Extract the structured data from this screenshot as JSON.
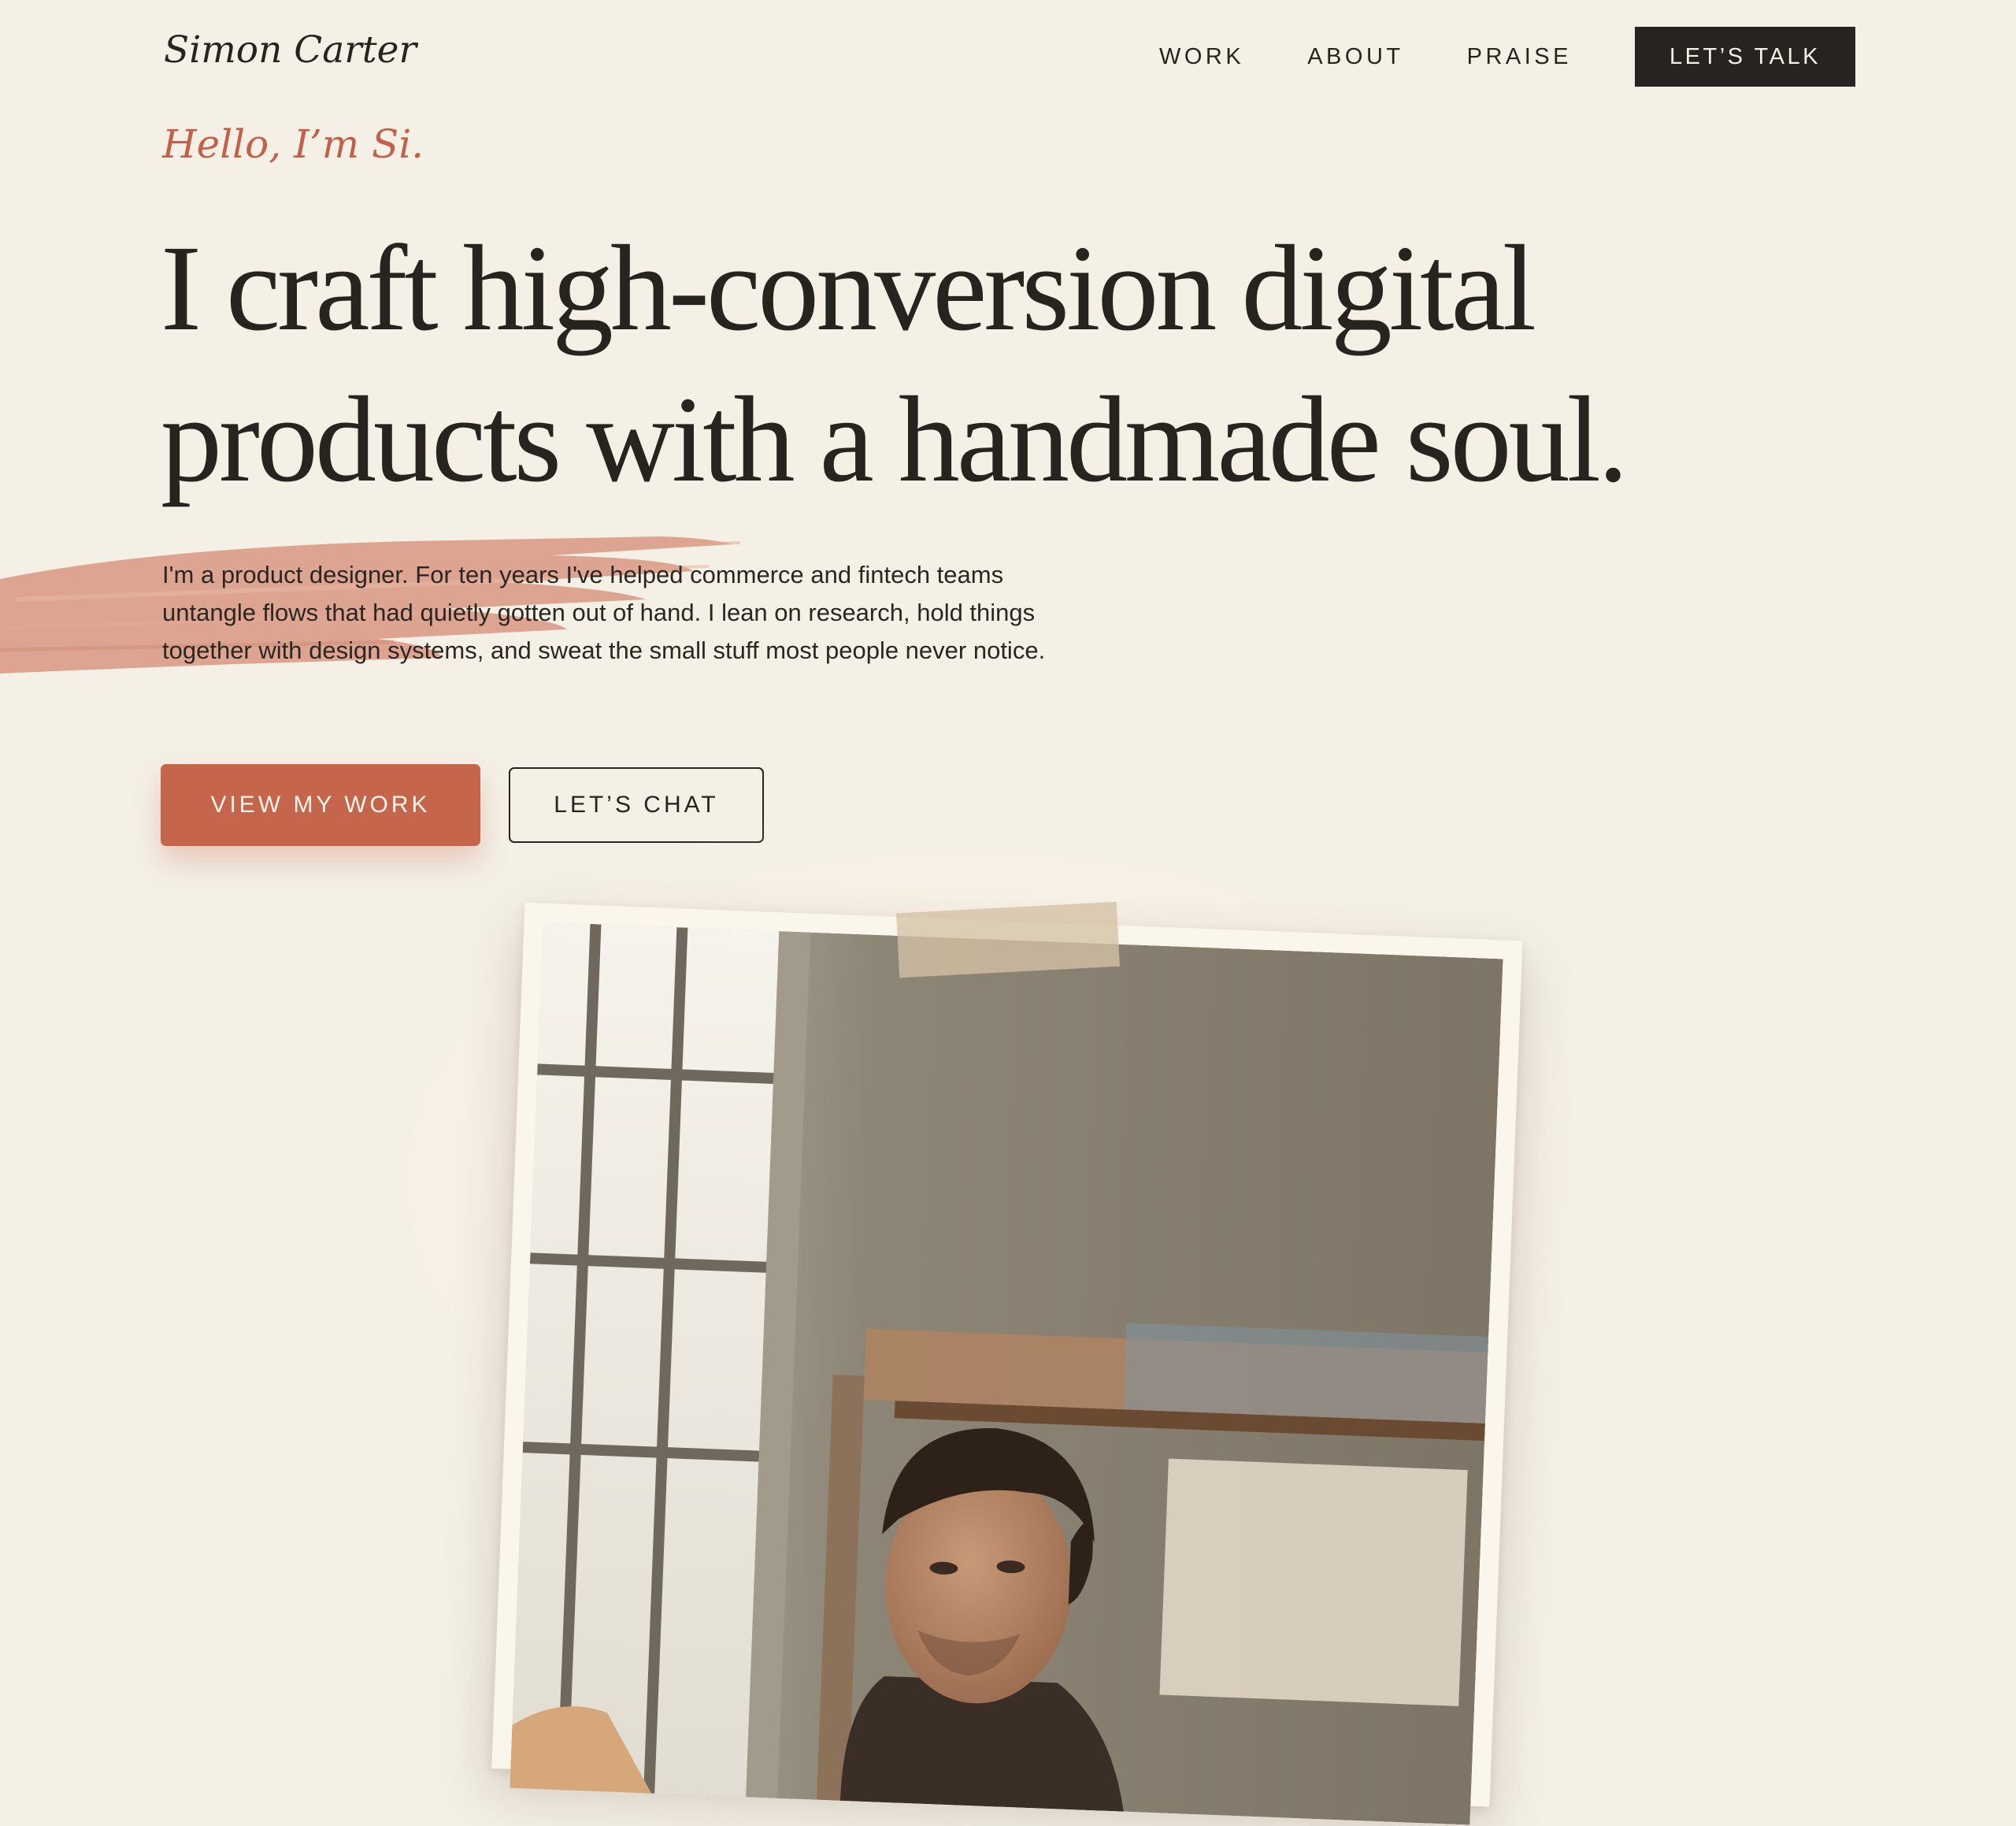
{
  "header": {
    "logo": "Simon Carter",
    "nav": {
      "work": "WORK",
      "about": "ABOUT",
      "praise": "PRAISE"
    },
    "cta": "LET’S TALK"
  },
  "hero": {
    "greeting": "Hello, I’m Si.",
    "headline": "I craft high-conversion digital products with a handmade soul.",
    "intro": "I'm a product designer. For ten years I've helped commerce and fintech teams untangle flows that had quietly gotten out of hand. I lean on research, hold things together with design systems, and sweat the small stuff most people never notice.",
    "primary_button": "VIEW MY WORK",
    "secondary_button": "LET’S CHAT"
  },
  "colors": {
    "background": "#f4f0e6",
    "ink": "#27231f",
    "accent": "#c4654c",
    "brush": "#d99a85",
    "photo_frame": "#fbf6ec"
  },
  "icons": {
    "brush": "brush-stroke",
    "tape": "masking-tape"
  }
}
